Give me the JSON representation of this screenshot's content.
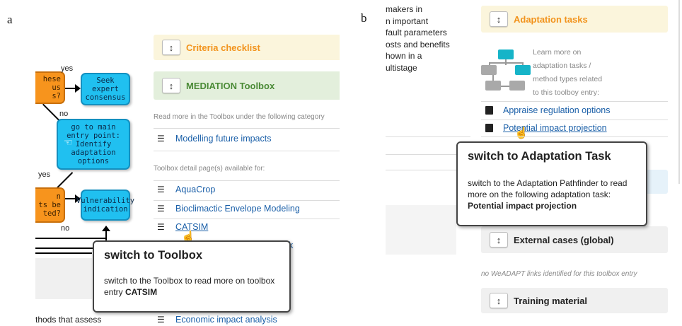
{
  "labels": {
    "a": "a",
    "b": "b"
  },
  "flowchart": {
    "node_q1": "hese\nus\ns?",
    "node_seek": "Seek\nexpert\nconsensus",
    "node_entry": "go to main\nentry point:\nIdentify\nadaptation\noptions",
    "node_q2": "n\nts be\nted?",
    "node_vuln": "Vulnerability\nindication",
    "yes1": "yes",
    "no1": "no",
    "yes2": "yes",
    "no2": "no"
  },
  "left_panel": {
    "criteria": {
      "label": "Criteria checklist",
      "color": "#f2931c"
    },
    "mediation": {
      "label": "MEDIATION Toolbox",
      "color": "#4a8a36"
    },
    "read_more": "Read more in the Toolbox under the following category",
    "category_link": "Modelling future impacts",
    "detail_heading": "Toolbox detail page(s) available for:",
    "tools": [
      "AquaCrop",
      "Bioclimactic Envelope Modeling",
      "CATSIM"
    ],
    "partial_link_char": "k",
    "bottom_link": "Economic impact analysis",
    "bottom_text": "thods that assess",
    "tooltip": {
      "title": "switch to Toolbox",
      "body": "switch to the Toolbox to read more on toolbox entry ",
      "body_bold": "CATSIM"
    }
  },
  "right_panel": {
    "side_text": [
      "makers in",
      "n important",
      "fault parameters",
      "osts and benefits",
      "hown in a",
      "ultistage"
    ],
    "adaptation": {
      "label": "Adaptation tasks",
      "color": "#f2931c"
    },
    "learn_more": [
      "Learn more on",
      "adaptation tasks /",
      "method types related",
      "to this toolboy entry:"
    ],
    "task_links": [
      "Appraise regulation options",
      "Potential impact projection"
    ],
    "tooltip": {
      "title": "switch to Adaptation Task",
      "body": "switch to the Adaptation Pathfinder to read more on the following adaptation task:",
      "body_bold": "Potential impact projection"
    },
    "external": {
      "label": "External cases (global)"
    },
    "no_weadapt": "no WeADAPT links identified for this toolbox entry",
    "training": {
      "label": "Training material"
    }
  },
  "icons": {
    "toggle": "toggle-icon",
    "list": "list-icon",
    "book": "book-icon",
    "cursor": "hand-cursor-icon",
    "diagram": "network-diagram-icon"
  },
  "colors": {
    "link": "#1a5fa8",
    "cyan_node": "#20c0f0",
    "orange_node": "#f7941d",
    "mediation_bg": "#e3efdc",
    "criteria_bg": "#fbf5dc"
  }
}
